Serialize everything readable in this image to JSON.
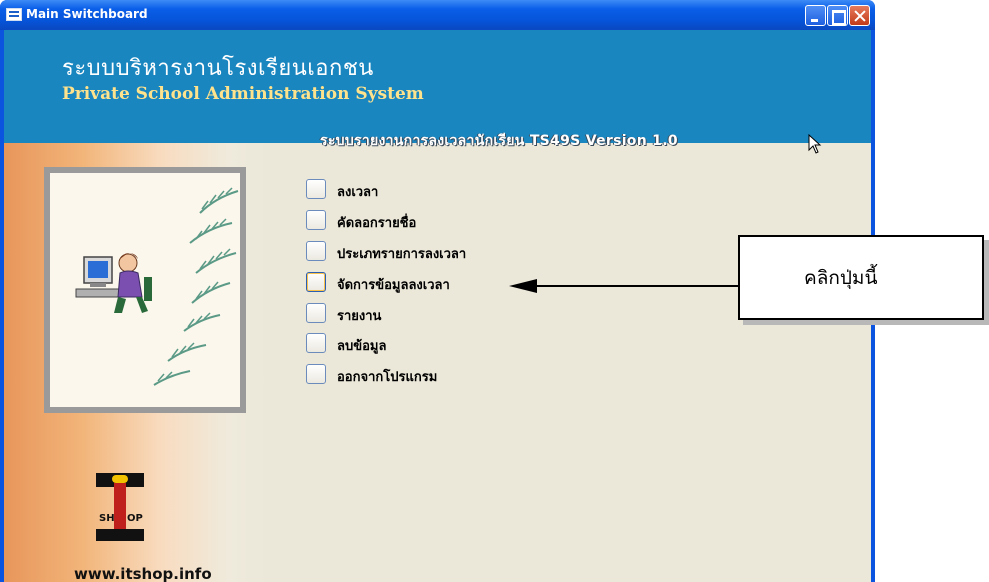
{
  "window": {
    "title": "Main Switchboard",
    "icon": "form-icon",
    "controls": [
      "minimize-icon",
      "maximize-icon",
      "close-icon"
    ]
  },
  "header": {
    "title_th": "ระบบบริหารงานโรงเรียนเอกชน",
    "title_en": "Private School Administration System",
    "subtitle": "ระบบรายงานการลงเวลานักเรียน TS49S Version 1.0"
  },
  "menu": {
    "items": [
      {
        "label": "ลงเวลา"
      },
      {
        "label": "คัดลอกรายชื่อ"
      },
      {
        "label": "ประเภทรายการลงเวลา"
      },
      {
        "label": "จัดการข้อมูลลงเวลา"
      },
      {
        "label": "รายงาน"
      },
      {
        "label": "ลบข้อมูล"
      },
      {
        "label": "ออกจากโปรแกรม"
      }
    ],
    "highlighted_index": 3
  },
  "branding": {
    "logo_letters": "SHOP",
    "url": "www.itshop.info"
  },
  "callout": {
    "text": "คลิกปุ่มนี้"
  },
  "colors": {
    "titlebar": "#0a5ee8",
    "header": "#1a86c0",
    "header_en_text": "#ffe38c",
    "client_bg": "#ebe8d9",
    "left_panel_orange": "#e8965a"
  }
}
